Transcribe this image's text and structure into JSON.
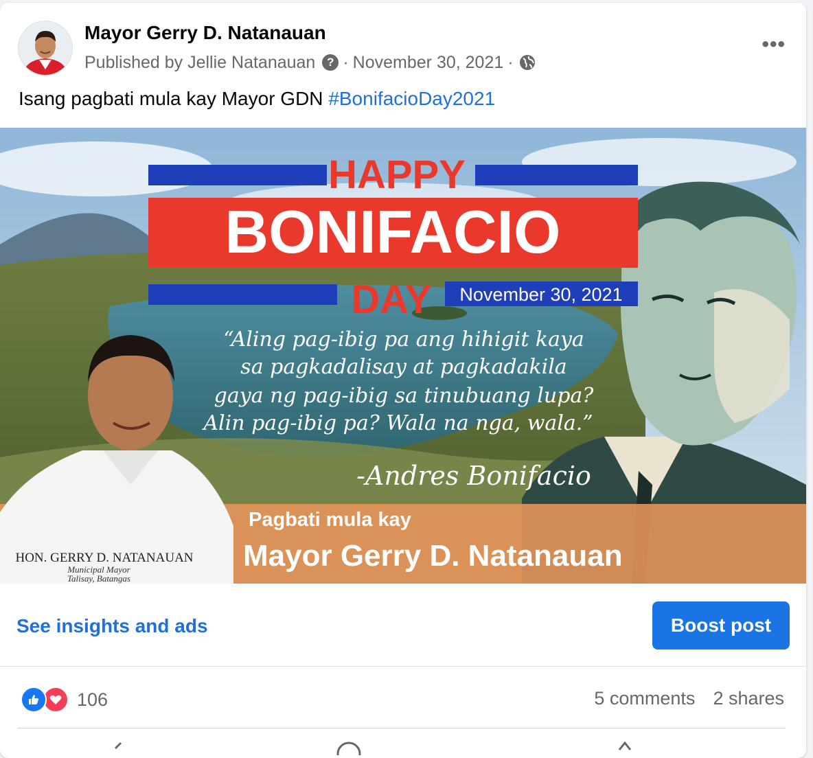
{
  "post": {
    "page_name": "Mayor Gerry D. Natanauan",
    "published_by": "Published by Jellie Natanauan",
    "date": "November 30, 2021",
    "separator": "·",
    "more_label": "•••",
    "caption_text": "Isang pagbati mula kay Mayor GDN ",
    "caption_hashtag": "#BonifacioDay2021"
  },
  "image": {
    "happy": "HAPPY",
    "bonifacio": "BONIFACIO",
    "day": "DAY",
    "date_badge": "November 30, 2021",
    "quote_line1": "“Aling pag-ibig pa ang hihigit kaya",
    "quote_line2": "sa pagkadalisay at pagkadakila",
    "quote_line3": "gaya ng pag-ibig sa tinubuang lupa?",
    "quote_line4": "Alin pag-ibig pa? Wala na nga, wala.”",
    "attribution": "-Andres Bonifacio",
    "greeting_small": "Pagbati mula kay",
    "greeting_large": "Mayor Gerry D. Natanauan",
    "nameplate_name": "HON. GERRY D. NATANAUAN",
    "nameplate_title": "Municipal Mayor",
    "nameplate_place": "Talisay, Batangas"
  },
  "actions": {
    "insights_label": "See insights and ads",
    "boost_label": "Boost post"
  },
  "engagement": {
    "reaction_count": "106",
    "comments": "5 comments",
    "shares": "2 shares",
    "reaction_icons": [
      "like-icon",
      "love-icon"
    ]
  },
  "colors": {
    "link_blue": "#216fdb",
    "boost_blue": "#1b74e4",
    "banner_red": "#e8392c",
    "bar_blue": "#1f3fba",
    "orange_band": "#e8945a"
  }
}
